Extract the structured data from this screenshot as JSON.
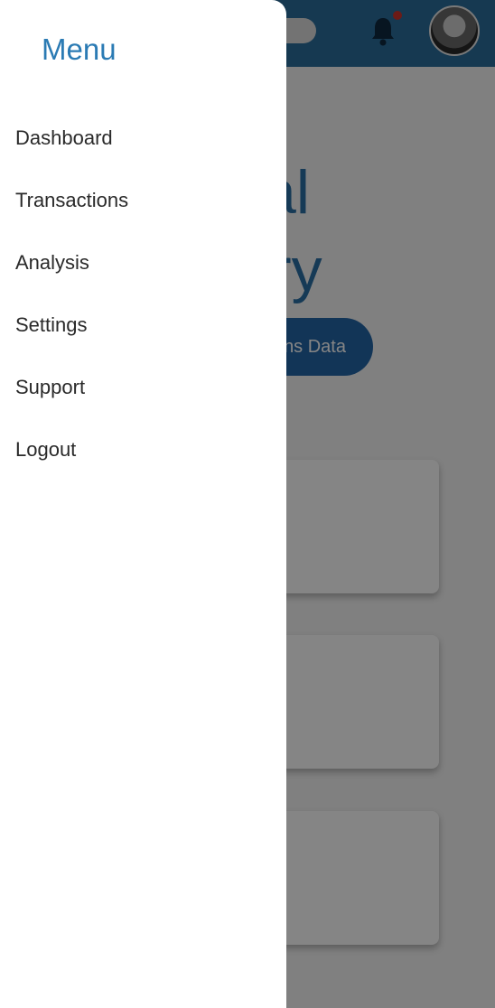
{
  "background_page": {
    "topbar": {
      "color": "#2b6d9c",
      "icons": [
        "theme-toggle",
        "bell-icon",
        "avatar"
      ]
    },
    "hero": {
      "line1": "al",
      "line2": "ry"
    },
    "button": {
      "label": "ns Data"
    },
    "cards": [
      {
        "text": ""
      },
      {
        "text": ")"
      },
      {
        "text": ""
      }
    ]
  },
  "drawer": {
    "title": "Menu",
    "items": [
      {
        "label": "Dashboard"
      },
      {
        "label": "Transactions"
      },
      {
        "label": "Analysis"
      },
      {
        "label": "Settings"
      },
      {
        "label": "Support"
      },
      {
        "label": "Logout"
      }
    ]
  },
  "colors": {
    "accent": "#2b7bb4",
    "topbar": "#2b6d9c",
    "button": "#2366a8",
    "notification_dot": "#d0342c"
  }
}
